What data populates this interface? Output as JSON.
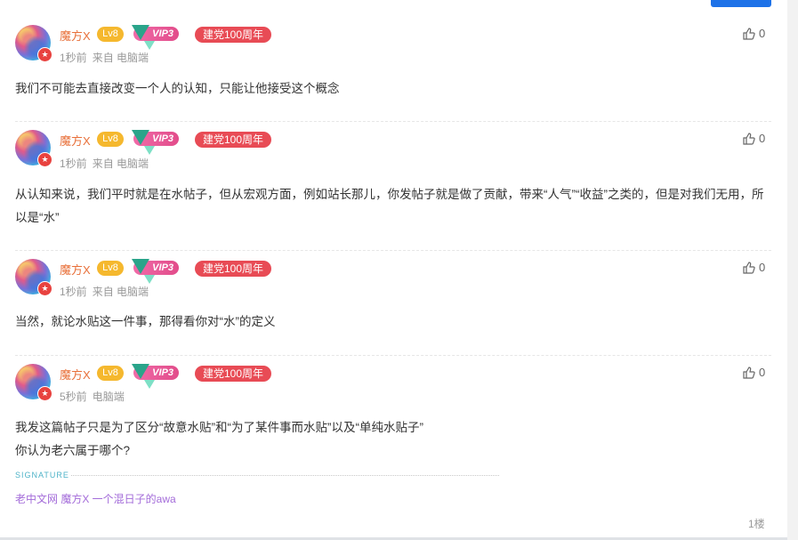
{
  "comments": [
    {
      "user": {
        "name": "魔方X",
        "level": "Lv8",
        "vip": "VIP3",
        "medal": "建党100周年"
      },
      "time": "1秒前",
      "source": "来自 电脑端",
      "likes": "0",
      "text": "我们不可能去直接改变一个人的认知，只能让他接受这个概念"
    },
    {
      "user": {
        "name": "魔方X",
        "level": "Lv8",
        "vip": "VIP3",
        "medal": "建党100周年"
      },
      "time": "1秒前",
      "source": "来自 电脑端",
      "likes": "0",
      "text": "从认知来说，我们平时就是在水帖子，但从宏观方面，例如站长那儿，你发帖子就是做了贡献，带来“人气”“收益”之类的，但是对我们无用，所以是“水”"
    },
    {
      "user": {
        "name": "魔方X",
        "level": "Lv8",
        "vip": "VIP3",
        "medal": "建党100周年"
      },
      "time": "1秒前",
      "source": "来自 电脑端",
      "likes": "0",
      "text": "当然，就论水贴这一件事，那得看你对“水”的定义"
    },
    {
      "user": {
        "name": "魔方X",
        "level": "Lv8",
        "vip": "VIP3",
        "medal": "建党100周年"
      },
      "time": "5秒前",
      "source": "电脑端",
      "likes": "0",
      "text_line1": "我发这篇帖子只是为了区分“故意水贴”和“为了某件事而水贴”以及“单纯水贴子”",
      "text_line2": "你认为老六属于哪个?",
      "signature_label": "SIGNATURE",
      "signature": "老中文网 魔方X 一个混日子的awa",
      "floor": "1楼"
    }
  ],
  "colors": {
    "accent": "#1d72e8",
    "username": "#e8703a",
    "level": "#f5b82e",
    "vip": "#e24c8a",
    "medal": "#e84b55",
    "signature": "#a36bd9"
  },
  "icons": {
    "like": "thumbs-up-icon",
    "avatar_badge": "star-badge-icon",
    "vip": "diamond-icon"
  }
}
